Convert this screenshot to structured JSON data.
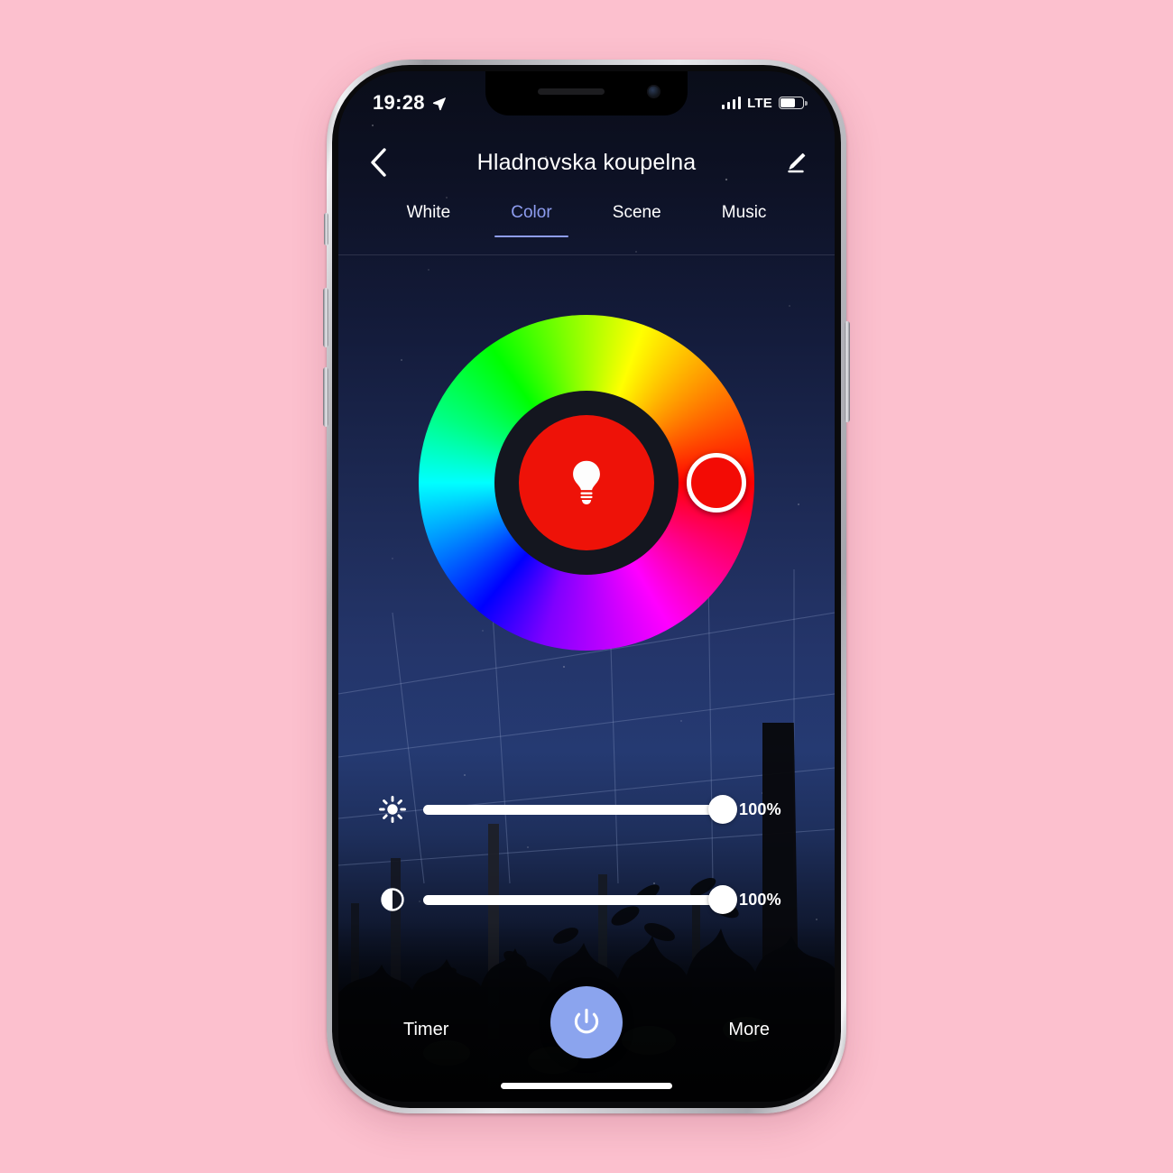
{
  "background_color": "#fcc0ce",
  "status_bar": {
    "time": "19:28",
    "location_icon": "location-arrow-icon",
    "signal_icon": "cellular-bars-icon",
    "network_label": "LTE",
    "battery_icon": "battery-icon",
    "battery_level_percent": 58
  },
  "header": {
    "back_icon": "chevron-left-icon",
    "title": "Hladnovska koupelna",
    "edit_icon": "pencil-edit-icon"
  },
  "tabs": {
    "items": [
      {
        "label": "White",
        "active": false
      },
      {
        "label": "Color",
        "active": true
      },
      {
        "label": "Scene",
        "active": false
      },
      {
        "label": "Music",
        "active": false
      }
    ],
    "active_color": "#8e9df0",
    "inactive_color": "#ffffff"
  },
  "color_wheel": {
    "name": "hue-color-wheel",
    "selected_color": "#f30b05",
    "selected_hue_degrees": 0,
    "center_color": "#ee1208",
    "center_icon": "lightbulb-icon",
    "handle_icon": "color-selector-handle",
    "ring_gap_color": "#14161f"
  },
  "sliders": [
    {
      "name": "brightness",
      "icon": "brightness-sun-icon",
      "value": 100,
      "value_label": "100%",
      "min": 0,
      "max": 100
    },
    {
      "name": "saturation",
      "icon": "contrast-half-circle-icon",
      "value": 100,
      "value_label": "100%",
      "min": 0,
      "max": 100
    }
  ],
  "bottom_bar": {
    "timer_label": "Timer",
    "power_icon": "power-icon",
    "power_color": "#8ba4ee",
    "more_label": "More"
  },
  "home_indicator": "home-indicator-bar"
}
